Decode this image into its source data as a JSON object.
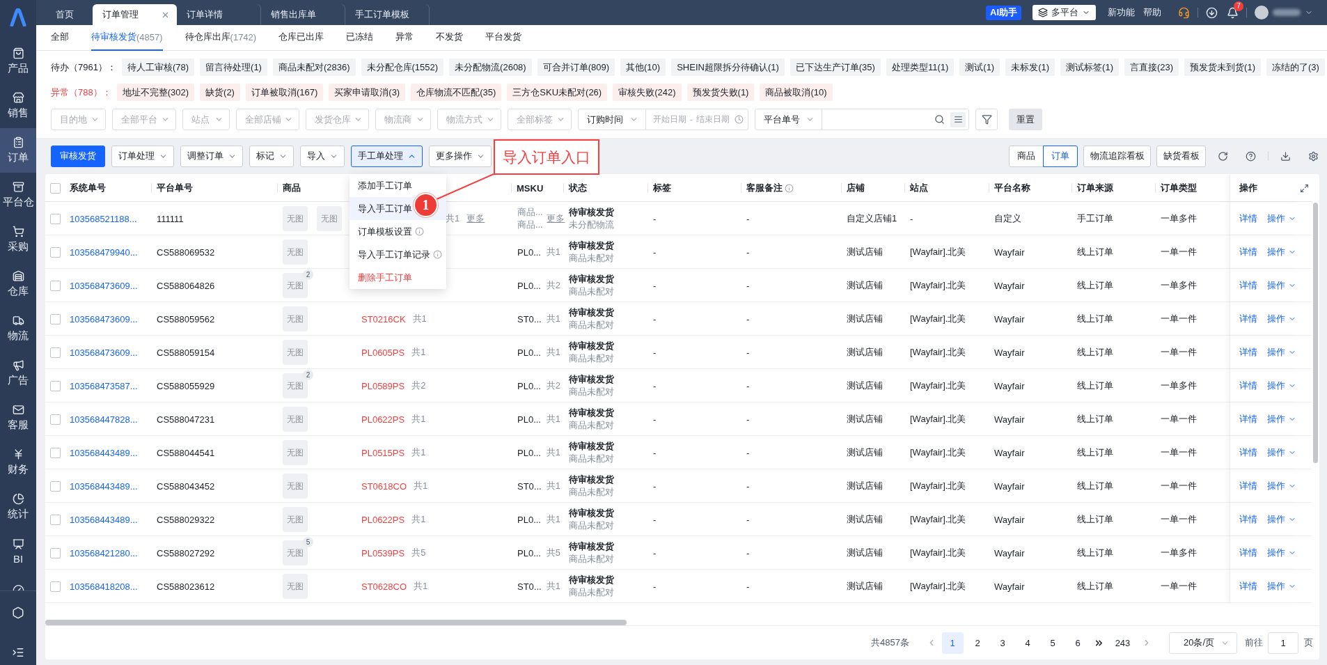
{
  "sidebar": {
    "items": [
      {
        "label": "产品",
        "selected": false
      },
      {
        "label": "销售",
        "selected": false
      },
      {
        "label": "订单",
        "selected": true
      },
      {
        "label": "平台仓",
        "selected": false
      },
      {
        "label": "采购",
        "selected": false
      },
      {
        "label": "仓库",
        "selected": false
      },
      {
        "label": "物流",
        "selected": false
      },
      {
        "label": "广告",
        "selected": false
      },
      {
        "label": "客服",
        "selected": false
      },
      {
        "label": "财务",
        "selected": false
      },
      {
        "label": "统计",
        "selected": false
      },
      {
        "label": "BI",
        "selected": false
      }
    ]
  },
  "tabs": [
    {
      "label": "首页",
      "selected": false
    },
    {
      "label": "订单管理",
      "selected": true
    },
    {
      "label": "订单详情",
      "selected": false
    },
    {
      "label": "销售出库单",
      "selected": false
    },
    {
      "label": "手工订单模板",
      "selected": false
    }
  ],
  "header": {
    "ai_button": "AI助手",
    "platform_select": "多平台",
    "links": [
      "新功能",
      "帮助"
    ],
    "notification_count": "7"
  },
  "status_tabs": [
    {
      "label": "全部",
      "selected": false
    },
    {
      "label": "待审核发货",
      "count": "(4857)",
      "selected": true
    },
    {
      "label": "待仓库出库",
      "count": "(1742)",
      "selected": false
    },
    {
      "label": "仓库已出库",
      "selected": false
    },
    {
      "label": "已冻结",
      "selected": false
    },
    {
      "label": "异常",
      "selected": false
    },
    {
      "label": "不发货",
      "selected": false
    },
    {
      "label": "平台发货",
      "selected": false
    }
  ],
  "tag_groups": [
    {
      "kind": "todo",
      "label": "待办（7961）：",
      "tags": [
        "待人工审核(78)",
        "留言待处理(1)",
        "商品未配对(2836)",
        "未分配仓库(1552)",
        "未分配物流(2608)",
        "可合并订单(809)",
        "其他(10)",
        "SHEIN超限拆分待确认(1)",
        "已下达生产订单(35)",
        "处理类型11(1)",
        "测试(1)",
        "未标发(1)",
        "测试标签(1)",
        "言直接(23)",
        "预发货未到货(1)",
        "冻结的了(3)"
      ]
    },
    {
      "kind": "exception",
      "label": "异常（788）：",
      "tags": [
        "地址不完整(302)",
        "缺货(2)",
        "订单被取消(167)",
        "买家申请取消(3)",
        "仓库物流不匹配(35)",
        "三方仓SKU未配对(26)",
        "审核失败(242)",
        "预发货失败(1)",
        "商品被取消(10)"
      ]
    }
  ],
  "filters": {
    "selects": [
      {
        "placeholder": "目的地"
      },
      {
        "placeholder": "全部平台"
      },
      {
        "placeholder": "站点"
      },
      {
        "placeholder": "全部店铺"
      },
      {
        "placeholder": "发货仓库"
      },
      {
        "placeholder": "物流商"
      },
      {
        "placeholder": "物流方式"
      },
      {
        "placeholder": "全部标签"
      }
    ],
    "date": {
      "type": "订购时间",
      "start_placeholder": "开始日期",
      "separator": "-",
      "end_placeholder": "结束日期"
    },
    "search": {
      "field": "平台单号"
    },
    "reset": "重置"
  },
  "toolbar": {
    "primary": "审核发货",
    "actions": [
      {
        "label": "订单处理",
        "open": false
      },
      {
        "label": "调整订单",
        "open": false
      },
      {
        "label": "标记",
        "open": false
      },
      {
        "label": "导入",
        "open": false
      },
      {
        "label": "手工单处理",
        "open": true
      },
      {
        "label": "更多操作",
        "open": false
      }
    ],
    "view_switch": [
      {
        "label": "商品",
        "selected": false
      },
      {
        "label": "订单",
        "selected": true
      }
    ],
    "boards": [
      "物流追踪看板",
      "缺货看板"
    ]
  },
  "manual_order_menu": {
    "items": [
      {
        "label": "添加手工订单",
        "kind": "plain",
        "highlighted": false
      },
      {
        "label": "导入手工订单",
        "kind": "plain",
        "highlighted": true
      },
      {
        "label": "订单模板设置",
        "kind": "info",
        "highlighted": false
      },
      {
        "label": "导入手工订单记录",
        "kind": "info",
        "highlighted": false
      },
      {
        "label": "删除手工订单",
        "kind": "danger",
        "highlighted": false
      }
    ]
  },
  "annotation": {
    "callout": "导入订单入口",
    "step": "1"
  },
  "table": {
    "all_selected": false,
    "columns": [
      {
        "label": "系统单号"
      },
      {
        "label": "平台单号"
      },
      {
        "label": "商品"
      },
      {
        "label": "MSKU"
      },
      {
        "label": "状态"
      },
      {
        "label": "标签"
      },
      {
        "label": "客服备注",
        "info": true
      },
      {
        "label": "店铺"
      },
      {
        "label": "站点"
      },
      {
        "label": "平台名称"
      },
      {
        "label": "订单来源"
      },
      {
        "label": "订单类型"
      },
      {
        "label": "操作"
      }
    ],
    "rows": [
      {
        "selected": false,
        "system_no": "103568521188...",
        "platform_no": "111111",
        "product": {
          "images": [
            {
              "label": "无图"
            },
            {
              "label": "无图"
            }
          ],
          "qty": "共1",
          "more": "更多"
        },
        "msku": {
          "kind": "multi",
          "lines": [
            "商品...",
            "商品..."
          ],
          "more": "更多"
        },
        "status": "待审核发货",
        "status_note": "未分配物流",
        "tag": "-",
        "note": "-",
        "store": "自定义店铺1",
        "site": "-",
        "platform": "自定义",
        "source": "手工订单",
        "type": "一单多件",
        "detail": "详情",
        "action": "操作"
      },
      {
        "selected": false,
        "system_no": "103568479940...",
        "platform_no": "CS588069532",
        "product": {
          "images": [
            {
              "label": "无图"
            }
          ]
        },
        "msku": {
          "kind": "code",
          "text": "PL0...",
          "qty": "共1"
        },
        "status": "待审核发货",
        "status_note": "商品未配对",
        "tag": "-",
        "note": "-",
        "store": "测试店铺",
        "site": "[Wayfair].北美",
        "platform": "Wayfair",
        "source": "线上订单",
        "type": "一单一件",
        "detail": "详情",
        "action": "操作"
      },
      {
        "selected": false,
        "system_no": "103568473609...",
        "platform_no": "CS588064826",
        "product": {
          "images": [
            {
              "label": "无图",
              "badge": "2"
            }
          ]
        },
        "msku": {
          "kind": "code",
          "text": "PL0...",
          "qty": "共2"
        },
        "status": "待审核发货",
        "status_note": "商品未配对",
        "tag": "-",
        "note": "-",
        "store": "测试店铺",
        "site": "[Wayfair].北美",
        "platform": "Wayfair",
        "source": "线上订单",
        "type": "一单多件",
        "detail": "详情",
        "action": "操作"
      },
      {
        "selected": false,
        "system_no": "103568473609...",
        "platform_no": "CS588059562",
        "product": {
          "images": [
            {
              "label": "无图"
            }
          ],
          "sku": "ST0216CK",
          "qty": "共1"
        },
        "msku": {
          "kind": "code",
          "text": "ST0...",
          "qty": "共1"
        },
        "status": "待审核发货",
        "status_note": "商品未配对",
        "tag": "-",
        "note": "-",
        "store": "测试店铺",
        "site": "[Wayfair].北美",
        "platform": "Wayfair",
        "source": "线上订单",
        "type": "一单一件",
        "detail": "详情",
        "action": "操作"
      },
      {
        "selected": false,
        "system_no": "103568473609...",
        "platform_no": "CS588059154",
        "product": {
          "images": [
            {
              "label": "无图"
            }
          ],
          "sku": "PL0605PS",
          "qty": "共1"
        },
        "msku": {
          "kind": "code",
          "text": "PL0...",
          "qty": "共1"
        },
        "status": "待审核发货",
        "status_note": "商品未配对",
        "tag": "-",
        "note": "-",
        "store": "测试店铺",
        "site": "[Wayfair].北美",
        "platform": "Wayfair",
        "source": "线上订单",
        "type": "一单一件",
        "detail": "详情",
        "action": "操作"
      },
      {
        "selected": false,
        "system_no": "103568473587...",
        "platform_no": "CS588055929",
        "product": {
          "images": [
            {
              "label": "无图",
              "badge": "2"
            }
          ],
          "sku": "PL0589PS",
          "qty": "共2"
        },
        "msku": {
          "kind": "code",
          "text": "PL0...",
          "qty": "共2"
        },
        "status": "待审核发货",
        "status_note": "商品未配对",
        "tag": "-",
        "note": "-",
        "store": "测试店铺",
        "site": "[Wayfair].北美",
        "platform": "Wayfair",
        "source": "线上订单",
        "type": "一单多件",
        "detail": "详情",
        "action": "操作"
      },
      {
        "selected": false,
        "system_no": "103568447828...",
        "platform_no": "CS588047231",
        "product": {
          "images": [
            {
              "label": "无图"
            }
          ],
          "sku": "PL0622PS",
          "qty": "共1"
        },
        "msku": {
          "kind": "code",
          "text": "PL0...",
          "qty": "共1"
        },
        "status": "待审核发货",
        "status_note": "商品未配对",
        "tag": "-",
        "note": "-",
        "store": "测试店铺",
        "site": "[Wayfair].北美",
        "platform": "Wayfair",
        "source": "线上订单",
        "type": "一单一件",
        "detail": "详情",
        "action": "操作"
      },
      {
        "selected": false,
        "system_no": "103568443489...",
        "platform_no": "CS588044541",
        "product": {
          "images": [
            {
              "label": "无图"
            }
          ],
          "sku": "PL0515PS",
          "qty": "共1"
        },
        "msku": {
          "kind": "code",
          "text": "PL0...",
          "qty": "共1"
        },
        "status": "待审核发货",
        "status_note": "商品未配对",
        "tag": "-",
        "note": "-",
        "store": "测试店铺",
        "site": "[Wayfair].北美",
        "platform": "Wayfair",
        "source": "线上订单",
        "type": "一单一件",
        "detail": "详情",
        "action": "操作"
      },
      {
        "selected": false,
        "system_no": "103568443489...",
        "platform_no": "CS588043452",
        "product": {
          "images": [
            {
              "label": "无图"
            }
          ],
          "sku": "ST0618CO",
          "qty": "共1"
        },
        "msku": {
          "kind": "code",
          "text": "ST0...",
          "qty": "共1"
        },
        "status": "待审核发货",
        "status_note": "商品未配对",
        "tag": "-",
        "note": "-",
        "store": "测试店铺",
        "site": "[Wayfair].北美",
        "platform": "Wayfair",
        "source": "线上订单",
        "type": "一单一件",
        "detail": "详情",
        "action": "操作"
      },
      {
        "selected": false,
        "system_no": "103568443489...",
        "platform_no": "CS588029322",
        "product": {
          "images": [
            {
              "label": "无图"
            }
          ],
          "sku": "PL0622PS",
          "qty": "共1"
        },
        "msku": {
          "kind": "code",
          "text": "PL0...",
          "qty": "共1"
        },
        "status": "待审核发货",
        "status_note": "商品未配对",
        "tag": "-",
        "note": "-",
        "store": "测试店铺",
        "site": "[Wayfair].北美",
        "platform": "Wayfair",
        "source": "线上订单",
        "type": "一单一件",
        "detail": "详情",
        "action": "操作"
      },
      {
        "selected": false,
        "system_no": "103568421280...",
        "platform_no": "CS588027292",
        "product": {
          "images": [
            {
              "label": "无图",
              "badge": "5"
            }
          ],
          "sku": "PL0539PS",
          "qty": "共5"
        },
        "msku": {
          "kind": "code",
          "text": "PL0...",
          "qty": "共5"
        },
        "status": "待审核发货",
        "status_note": "商品未配对",
        "tag": "-",
        "note": "-",
        "store": "测试店铺",
        "site": "[Wayfair].北美",
        "platform": "Wayfair",
        "source": "线上订单",
        "type": "一单多件",
        "detail": "详情",
        "action": "操作"
      },
      {
        "selected": false,
        "system_no": "103568418208...",
        "platform_no": "CS588023612",
        "product": {
          "images": [
            {
              "label": "无图"
            }
          ],
          "sku": "ST0628CO",
          "qty": "共1"
        },
        "msku": {
          "kind": "code",
          "text": "ST0...",
          "qty": "共1"
        },
        "status": "待审核发货",
        "status_note": "商品未配对",
        "tag": "-",
        "note": "-",
        "store": "测试店铺",
        "site": "[Wayfair].北美",
        "platform": "Wayfair",
        "source": "线上订单",
        "type": "一单一件",
        "detail": "详情",
        "action": "操作"
      }
    ]
  },
  "pagination": {
    "total": "共4857条",
    "pages": [
      {
        "label": "1",
        "selected": true
      },
      {
        "label": "2",
        "selected": false
      },
      {
        "label": "3",
        "selected": false
      },
      {
        "label": "4",
        "selected": false
      },
      {
        "label": "5",
        "selected": false
      },
      {
        "label": "6",
        "selected": false
      }
    ],
    "last_page": "243",
    "page_size": "20条/页",
    "goto_label": "前往",
    "goto_value": "1",
    "page_suffix": "页"
  }
}
